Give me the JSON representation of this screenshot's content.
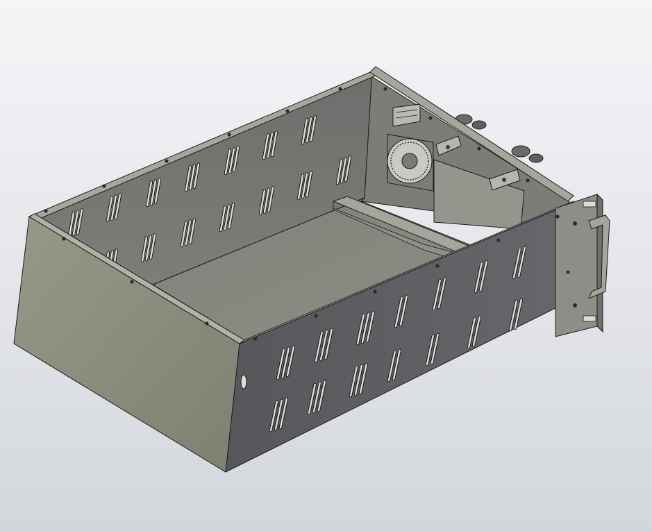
{
  "viewport": {
    "background_top": "#f4f5f7",
    "background_bottom": "#d3d6dc"
  },
  "model": {
    "kind": "sheet-metal-enclosure",
    "colors": {
      "outer_front_face": "#8b8b7c",
      "side_face": "#5b5c5d",
      "inner_wall": "#7a7b76",
      "floor": "#86877f",
      "rim": "#a6a79c",
      "edge": "#1a1a1a",
      "slot": "#dcddd6",
      "rail": "#a9aa9f",
      "bracket": "#9a9b94"
    },
    "icons": [
      "cooling-fan-icon",
      "d-sub-connector-icon",
      "handle-icon",
      "cable-gland-icon"
    ]
  }
}
